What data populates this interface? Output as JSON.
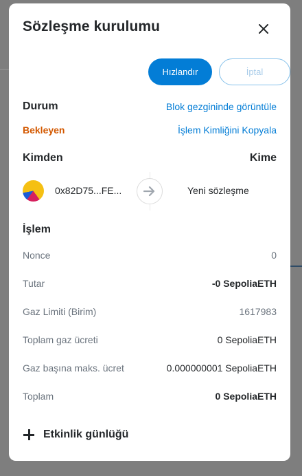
{
  "modal": {
    "title": "Sözleşme kurulumu"
  },
  "actions": {
    "speed_up_label": "Hızlandır",
    "cancel_label": "İptal"
  },
  "status": {
    "heading": "Durum",
    "view_explorer_link": "Blok gezgininde görüntüle",
    "state": "Bekleyen",
    "copy_tx_id_link": "İşlem Kimliğini Kopyala"
  },
  "parties": {
    "from_label": "Kimden",
    "to_label": "Kime",
    "from_address": "0x82D75...FE...",
    "to_name": "Yeni sözleşme"
  },
  "transaction": {
    "heading": "İşlem",
    "rows": [
      {
        "key": "Nonce",
        "value": "0"
      },
      {
        "key": "Tutar",
        "value": "-0 SepoliaETH"
      },
      {
        "key": "Gaz Limiti (Birim)",
        "value": "1617983"
      },
      {
        "key": "Toplam gaz ücreti",
        "value": "0 SepoliaETH"
      },
      {
        "key": "Gaz başına maks. ücret",
        "value": "0.000000001 SepoliaETH"
      },
      {
        "key": "Toplam",
        "value": "0 SepoliaETH"
      }
    ]
  },
  "activity": {
    "label": "Etkinlik günlüğü"
  },
  "colors": {
    "primary": "#037dd6",
    "pending": "#d35800",
    "overlay": "#7e7e7e"
  }
}
